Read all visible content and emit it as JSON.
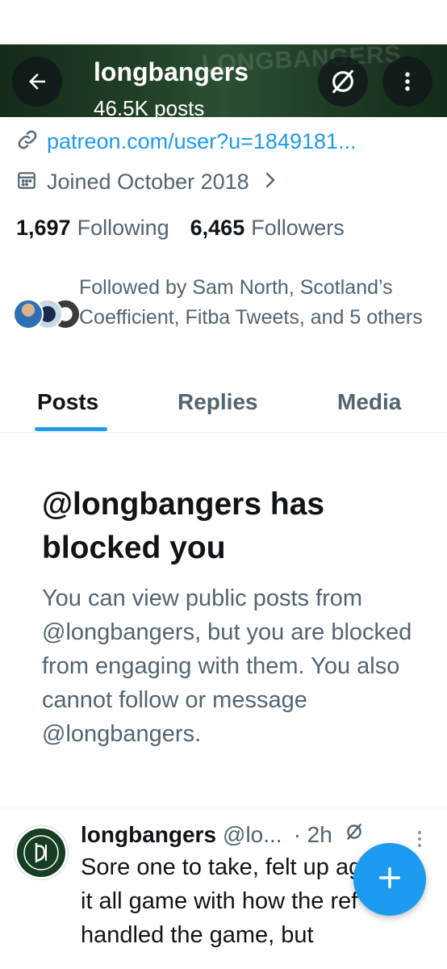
{
  "header": {
    "title": "longbangers",
    "subtitle": "46.5K posts",
    "banner_text": "LONGBANGERS"
  },
  "profile": {
    "link": "patreon.com/user?u=1849181...",
    "joined": "Joined October 2018",
    "following_count": "1,697",
    "following_label": "Following",
    "followers_count": "6,465",
    "followers_label": "Followers",
    "followed_by": "Followed by Sam North, Scotland’s Coefficient, Fitba Tweets, and 5 others"
  },
  "tabs": [
    {
      "label": "Posts",
      "active": true
    },
    {
      "label": "Replies",
      "active": false
    },
    {
      "label": "Media",
      "active": false
    }
  ],
  "blocked": {
    "title": "@longbangers has blocked you",
    "description": "You can view public posts from @longbangers, but you are blocked from engaging with them. You also cannot follow or message @longbangers."
  },
  "post": {
    "name": "longbangers",
    "handle": "@lo...",
    "time": "· 2h",
    "text": "Sore one to take, felt up against it all game with how the ref handled the game, but"
  },
  "icons": {
    "back": "arrow-left-icon",
    "grok": "grok-icon",
    "more": "more-vertical-icon",
    "link": "link-icon",
    "calendar": "calendar-icon",
    "chevron": "chevron-right-icon",
    "compose": "plus-icon"
  },
  "colors": {
    "accent": "#1d9bf0",
    "text_primary": "#0f1419",
    "text_secondary": "#536471",
    "banner_green": "#2c5433"
  }
}
